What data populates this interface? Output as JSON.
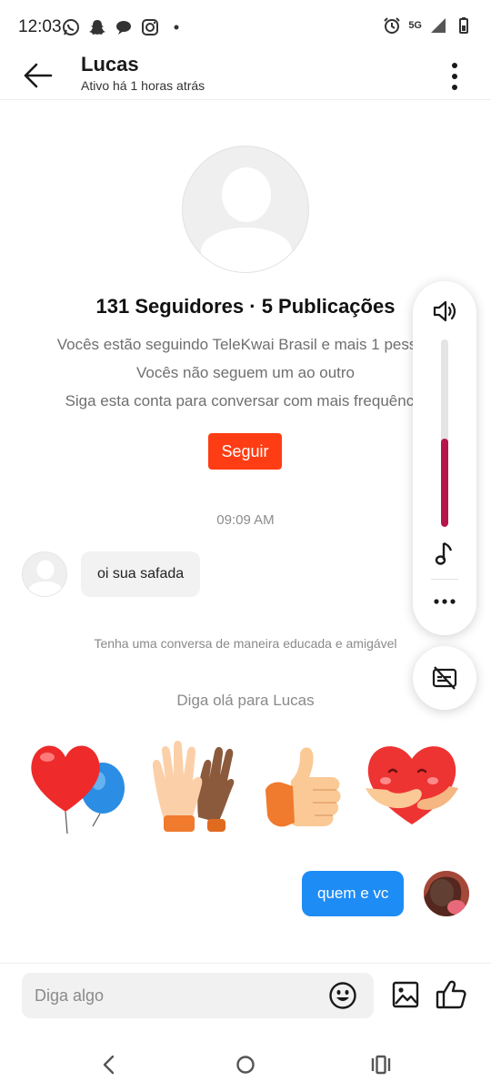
{
  "status_bar": {
    "time": "12:03",
    "network": "5G",
    "left_icons": [
      "whatsapp-icon",
      "snapchat-icon",
      "chat-bubble-icon",
      "instagram-icon",
      "dot-icon"
    ],
    "right_icons": [
      "alarm-icon",
      "signal-icon",
      "battery-icon"
    ]
  },
  "header": {
    "name": "Lucas",
    "subtitle": "Ativo há 1 horas atrás"
  },
  "profile": {
    "stats": "131 Seguidores · 5 Publicações",
    "line1": "Vocês estão seguindo TeleKwai Brasil e mais 1 pessoa",
    "line2": "Vocês não seguem um ao outro",
    "line3": "Siga esta conta para conversar com mais frequência",
    "follow_label": "Seguir"
  },
  "chat": {
    "time": "09:09 AM",
    "incoming_message": "oi sua safada",
    "notice": "Tenha uma conversa de maneira educada e amigável",
    "greet": "Diga olá para Lucas",
    "stickers": [
      "heart-balloon-sticker",
      "high-five-sticker",
      "thumbs-up-sticker",
      "heart-hug-sticker"
    ],
    "outgoing_message": "quem e vc"
  },
  "volume_panel": {
    "level": 0.47,
    "fill_color": "#b6154e"
  },
  "input": {
    "placeholder": "Diga algo",
    "value": ""
  },
  "colors": {
    "follow_button": "#fe3d14",
    "outgoing_bubble": "#1e8cf5"
  }
}
